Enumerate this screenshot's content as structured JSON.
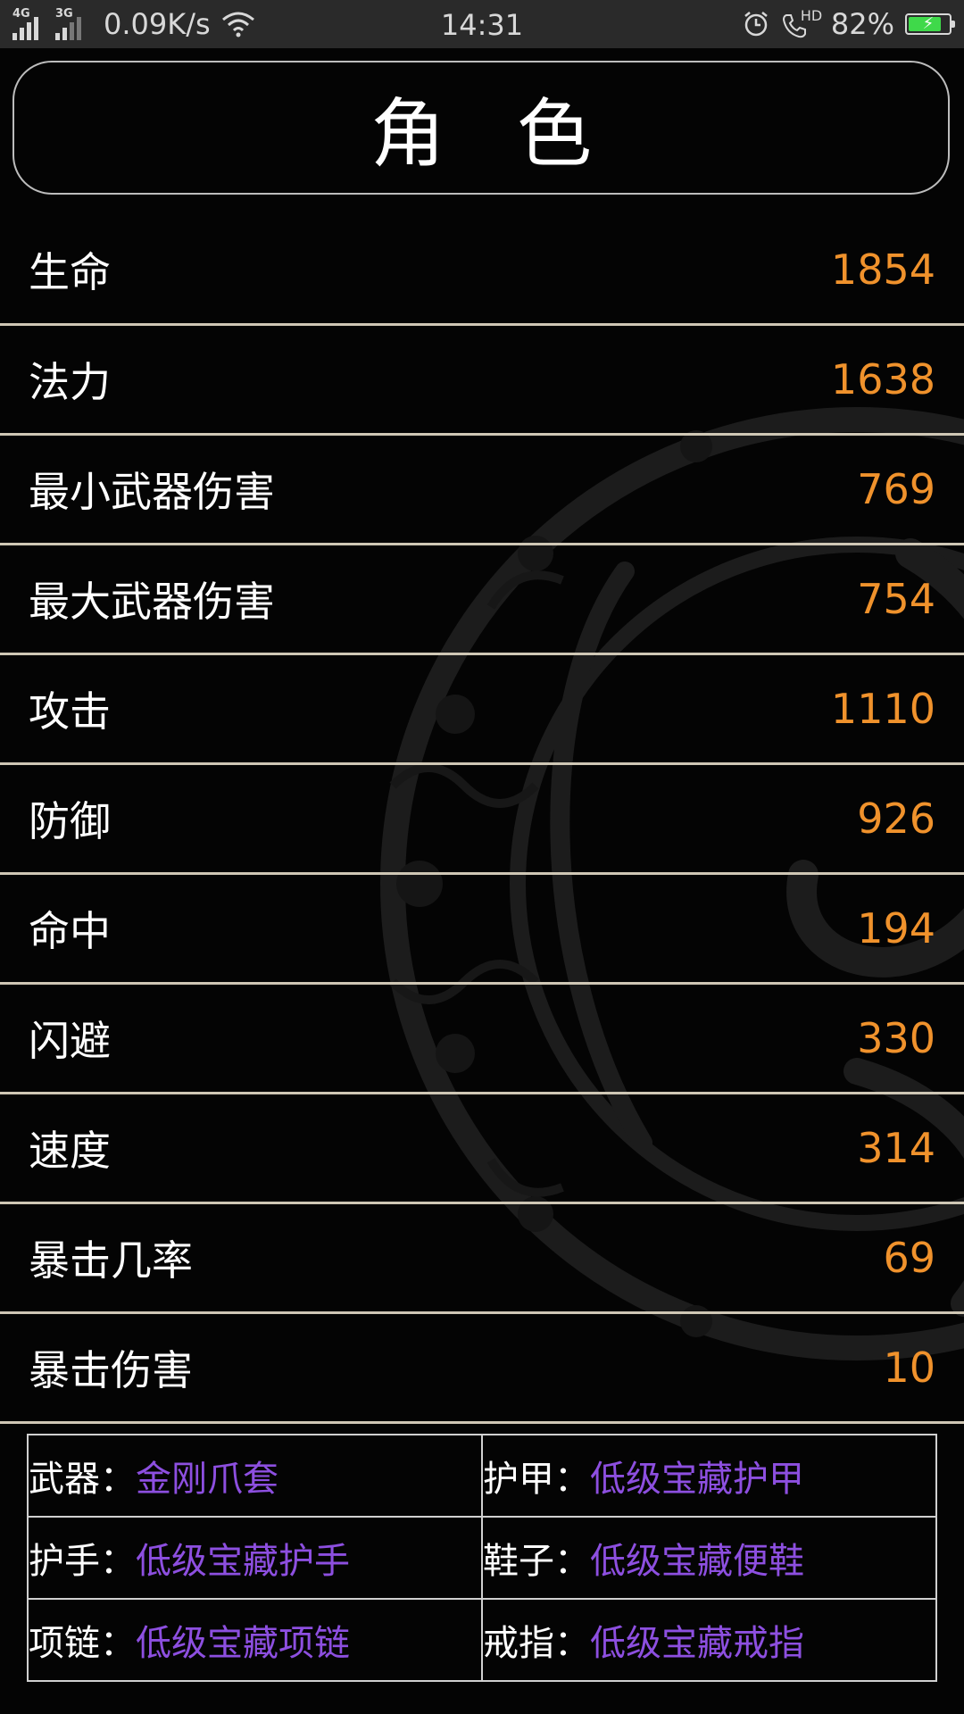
{
  "status_bar": {
    "network_1": "4G",
    "network_2": "3G",
    "net_speed": "0.09K/s",
    "time": "14:31",
    "hd_label": "HD",
    "battery_percent": "82%",
    "battery_level": 0.82,
    "battery_color": "#3fd94a",
    "icons": [
      "signal-4g-icon",
      "signal-3g-icon",
      "wifi-icon",
      "alarm-icon",
      "hd-call-icon",
      "battery-icon"
    ]
  },
  "header": {
    "title": "角色"
  },
  "stats": [
    {
      "label": "生命",
      "value": "1854"
    },
    {
      "label": "法力",
      "value": "1638"
    },
    {
      "label": "最小武器伤害",
      "value": "769"
    },
    {
      "label": "最大武器伤害",
      "value": "754"
    },
    {
      "label": "攻击",
      "value": "1110"
    },
    {
      "label": "防御",
      "value": "926"
    },
    {
      "label": "命中",
      "value": "194"
    },
    {
      "label": "闪避",
      "value": "330"
    },
    {
      "label": "速度",
      "value": "314"
    },
    {
      "label": "暴击几率",
      "value": "69"
    },
    {
      "label": "暴击伤害",
      "value": "10"
    }
  ],
  "equipment": [
    {
      "slot": "武器：",
      "item": "金刚爪套"
    },
    {
      "slot": "护甲：",
      "item": "低级宝藏护甲"
    },
    {
      "slot": "护手：",
      "item": "低级宝藏护手"
    },
    {
      "slot": "鞋子：",
      "item": "低级宝藏便鞋"
    },
    {
      "slot": "项链：",
      "item": "低级宝藏项链"
    },
    {
      "slot": "戒指：",
      "item": "低级宝藏戒指"
    }
  ],
  "colors": {
    "stat_value": "#f0922c",
    "item_name": "#8d4fe0",
    "divider": "#cfc7b5"
  }
}
